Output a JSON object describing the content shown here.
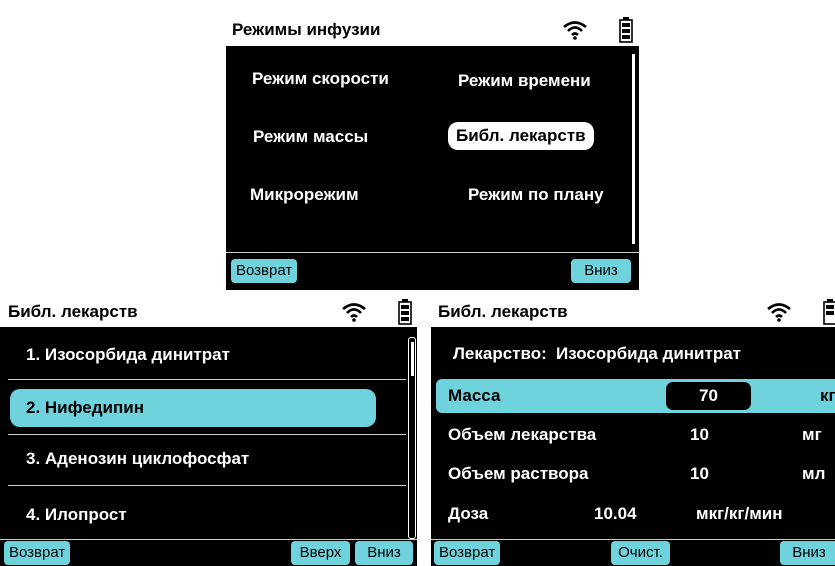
{
  "screen1": {
    "title": "Режимы инфузии",
    "options": [
      "Режим скорости",
      "Режим времени",
      "Режим массы",
      "Библ. лекарств",
      "Микрорежим",
      "Режим по плану"
    ],
    "selected": "Библ. лекарств",
    "softkeys": {
      "left": "Возврат",
      "right": "Вниз"
    }
  },
  "screen2": {
    "title": "Библ. лекарств",
    "items": [
      "1. Изосорбида динитрат",
      "2. Нифедипин",
      "3. Аденозин циклофосфат",
      "4. Илопрост"
    ],
    "selected": "2. Нифедипин",
    "softkeys": {
      "left": "Возврат",
      "middle": "Вверх",
      "right": "Вниз"
    }
  },
  "screen3": {
    "title": "Библ. лекарств",
    "drug_label": "Лекарство:",
    "drug_name": "Изосорбида динитрат",
    "rows": [
      {
        "label": "Масса",
        "value": "70",
        "unit": "кг"
      },
      {
        "label": "Объем лекарства",
        "value": "10",
        "unit": "мг"
      },
      {
        "label": "Объем раствора",
        "value": "10",
        "unit": "мл"
      },
      {
        "label": "Доза",
        "value": "10.04",
        "unit": "мкг/кг/мин"
      }
    ],
    "softkeys": {
      "left": "Возврат",
      "middle": "Очист.",
      "right": "Вниз"
    }
  },
  "colors": {
    "accent": "#6fd3dd",
    "screen_bg": "#000000",
    "titlebar_bg": "#ffffff"
  }
}
